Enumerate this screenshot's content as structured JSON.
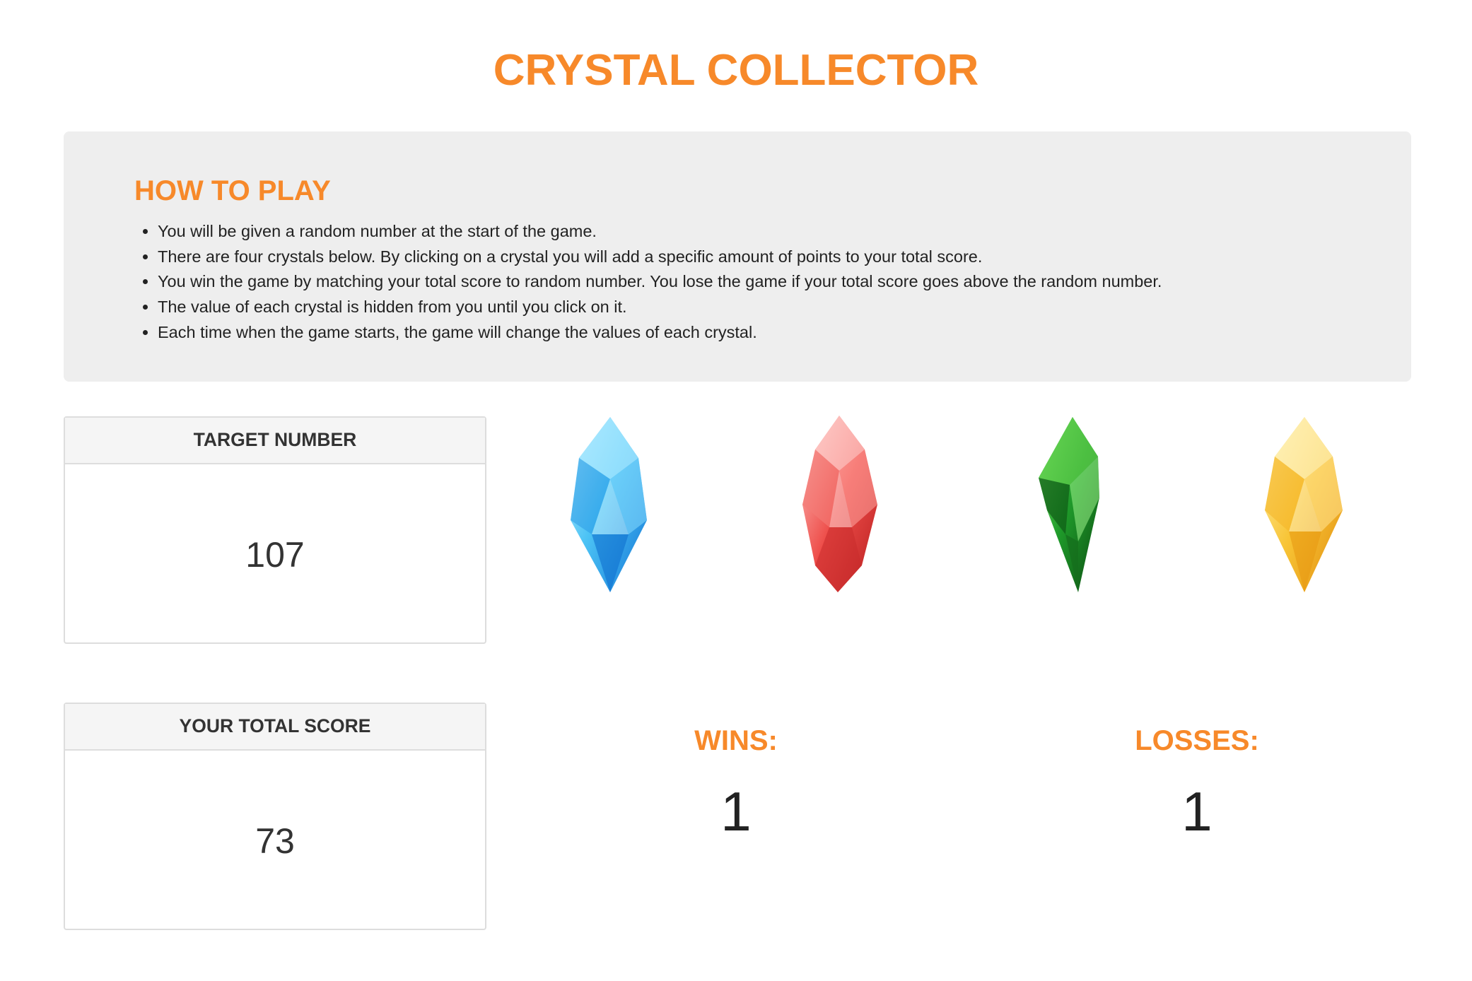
{
  "header": {
    "title": "CRYSTAL COLLECTOR"
  },
  "colors": {
    "accent": "#f7892a",
    "panel_bg": "#eeeeee",
    "border": "#dddddd"
  },
  "how_to_play": {
    "heading": "HOW TO PLAY",
    "rules": [
      "You will be given a random number at the start of the game.",
      "There are four crystals below. By clicking on a crystal you will add a specific amount of points to your total score.",
      "You win the game by matching your total score to random number. You lose the game if your total score goes above the random number.",
      "The value of each crystal is hidden from you until you click on it.",
      "Each time when the game starts, the game will change the values of each crystal."
    ]
  },
  "target": {
    "label": "TARGET NUMBER",
    "value": "107"
  },
  "score": {
    "label": "YOUR TOTAL SCORE",
    "value": "73"
  },
  "crystals": [
    {
      "name": "blue-crystal",
      "color": "#3ab0ef"
    },
    {
      "name": "red-crystal",
      "color": "#e8413f"
    },
    {
      "name": "green-crystal",
      "color": "#1f9a2a"
    },
    {
      "name": "yellow-crystal",
      "color": "#f6b52c"
    }
  ],
  "wins": {
    "label": "WINS:",
    "value": "1"
  },
  "losses": {
    "label": "LOSSES:",
    "value": "1"
  }
}
